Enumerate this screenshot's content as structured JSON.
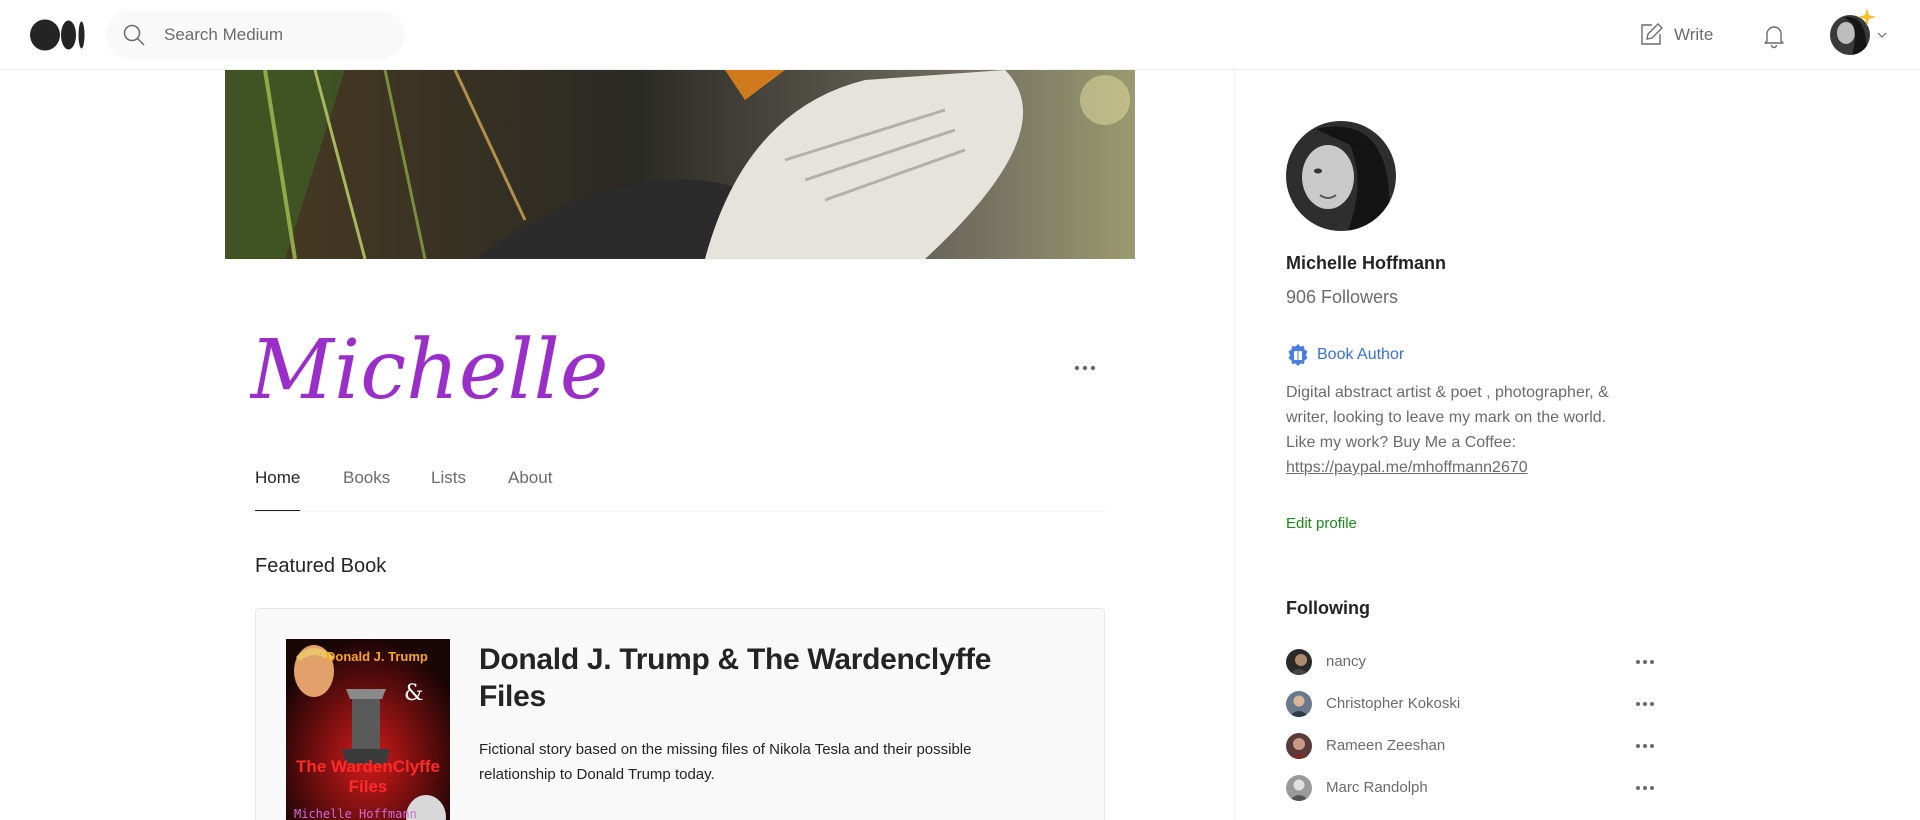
{
  "header": {
    "search_placeholder": "Search Medium",
    "write_label": "Write"
  },
  "profile": {
    "signature": "Michelle :)",
    "name": "Michelle Hoffmann",
    "followers": "906 Followers",
    "badge": "Book Author",
    "bio_line1": "Digital abstract artist & poet , photographer, &",
    "bio_line2": "writer, looking to leave my mark on the world.",
    "bio_line3": "Like my work? Buy Me a Coffee:",
    "bio_link": "https://paypal.me/mhoffmann2670",
    "edit_label": "Edit profile"
  },
  "tabs": [
    {
      "label": "Home"
    },
    {
      "label": "Books"
    },
    {
      "label": "Lists"
    },
    {
      "label": "About"
    }
  ],
  "featured": {
    "section_title": "Featured Book",
    "book_title": "Donald J. Trump & The Wardenclyffe Files",
    "description": "Fictional story based on the missing files of Nikola Tesla and their possible relationship to Donald Trump today.",
    "cover_top": "Donald J. Trump",
    "cover_amp": "&",
    "cover_main": "The WardenClyffe Files",
    "cover_author": "Michelle Hoffmann"
  },
  "following": {
    "title": "Following",
    "items": [
      {
        "name": "nancy"
      },
      {
        "name": "Christopher Kokoski"
      },
      {
        "name": "Rameen Zeeshan"
      },
      {
        "name": "Marc Randolph"
      }
    ]
  },
  "colors": {
    "accent_green": "#1a8917",
    "badge_blue": "#3b71d4",
    "signature_purple": "#9a2ec9"
  }
}
